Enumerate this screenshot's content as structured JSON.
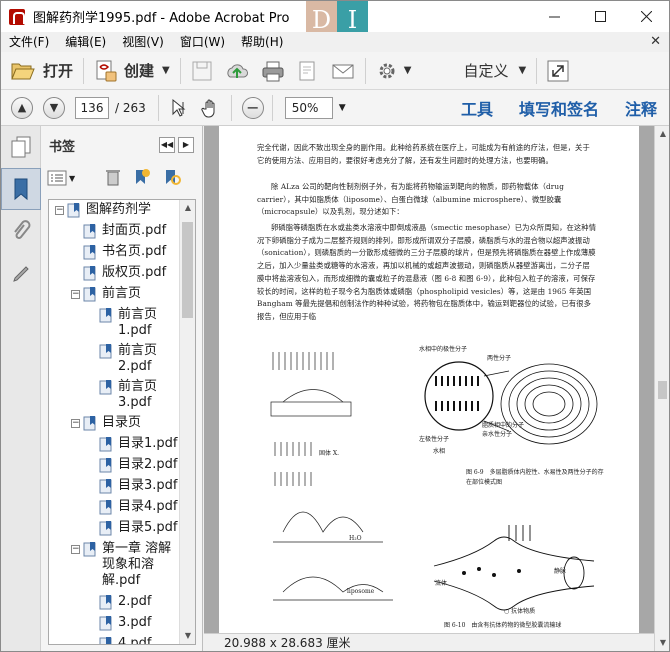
{
  "window": {
    "title": "图解药剂学1995.pdf - Adobe Acrobat Pro",
    "logo_letters": [
      "D",
      "I"
    ]
  },
  "menu": [
    "文件(F)",
    "编辑(E)",
    "视图(V)",
    "窗口(W)",
    "帮助(H)"
  ],
  "toolbar": {
    "open_label": "打开",
    "create_label": "创建",
    "customize_label": "自定义"
  },
  "nav": {
    "current_page": "136",
    "total_pages": "/ 263",
    "zoom": "50%"
  },
  "right_links": [
    "工具",
    "填写和签名",
    "注释"
  ],
  "bookmarks_panel": {
    "title": "书签",
    "items": [
      {
        "label": "图解药剂学",
        "level": 0,
        "expanded": true
      },
      {
        "label": "封面页.pdf",
        "level": 1
      },
      {
        "label": "书名页.pdf",
        "level": 1
      },
      {
        "label": "版权页.pdf",
        "level": 1
      },
      {
        "label": "前言页",
        "level": 1,
        "expanded": true
      },
      {
        "label": "前言页1.pdf",
        "level": 2
      },
      {
        "label": "前言页2.pdf",
        "level": 2
      },
      {
        "label": "前言页3.pdf",
        "level": 2
      },
      {
        "label": "目录页",
        "level": 1,
        "expanded": true
      },
      {
        "label": "目录1.pdf",
        "level": 2
      },
      {
        "label": "目录2.pdf",
        "level": 2
      },
      {
        "label": "目录3.pdf",
        "level": 2
      },
      {
        "label": "目录4.pdf",
        "level": 2
      },
      {
        "label": "目录5.pdf",
        "level": 2
      },
      {
        "label": "第一章 溶解现象和溶解.pdf",
        "level": 1,
        "expanded": true
      },
      {
        "label": "2.pdf",
        "level": 2
      },
      {
        "label": "3.pdf",
        "level": 2
      },
      {
        "label": "4.pdf",
        "level": 2
      }
    ]
  },
  "document": {
    "paragraphs": [
      "完全代谢，因此不致出现全身的副作用。此种给药系统在医疗上，可能成为有前途的疗法，但是，关于它的使用方法、应用目的，要很好考虑充分了解，还有发生问题时的处理方法，也要明确。",
      "除 ALza 公司的靶向性制剂例子外，有为能将药物输运到靶向的物质，即药物载体（drug carrier），其中如脂质体（liposome）、白蛋白微球（albumine microsphere）、微型胶囊（microcapsule）以及乳剂，现分述如下：",
      "卵磷脂等磷脂质在水或盐类水溶液中即倒成液晶（smectic mesophase）已为众所周知，在这种情况下卵磷脂分子成为二层整齐规则的排列，即形成所谓双分子层膜，磷脂质与水的混合物以超声波振动（sonication），则磷脂质的一分散形成细微的三分子层膜的球片，但是预先将磷脂质在器壁上作成薄膜之后，加入少量盐类或糖等的水溶液，再加以机械的或超声波振动，则磷脂质从器壁游离出，二分子层膜中将盐溶液包入，而形成细微的囊或粒子的混悬液（图 6-8 和图 6-9），此种包入粒子的溶液，可保存较长的时间，这样的粒子现今名为脂质体或磷脂（phospholipid vesicles）等，这是由 1965 年英国 Bangham 等最先提倡和创制法作的种种试验，将药物包在脂质体中，输运到靶器位的试验，已有很多报告，但应用于临"
    ],
    "figure_captions": [
      "图 6-9　多层脂质体内腔性、水易性及两性分子的存在部位模式图",
      "图 6-10　由含有抗体药物的微型胶囊流输球"
    ],
    "figure_labels": {
      "fig9_top": "水相中的极性分子",
      "fig9_a": "两性分子",
      "fig9_b": "脂质相中的分子",
      "fig9_c": "亲水性分子",
      "fig9_d": "左极性分子",
      "fig9_e": "水相",
      "fig8_a": "H₂O",
      "fig8_b": "liposome",
      "fig8_c": "固体 X.",
      "fig10_a": "流体",
      "fig10_b": "静脉",
      "fig10_c": "○ 抗体物质"
    }
  },
  "status": {
    "page_size": "20.988 x 28.683 厘米"
  },
  "colors": {
    "accent_blue": "#1f5ea8",
    "app_red": "#b30b00"
  }
}
